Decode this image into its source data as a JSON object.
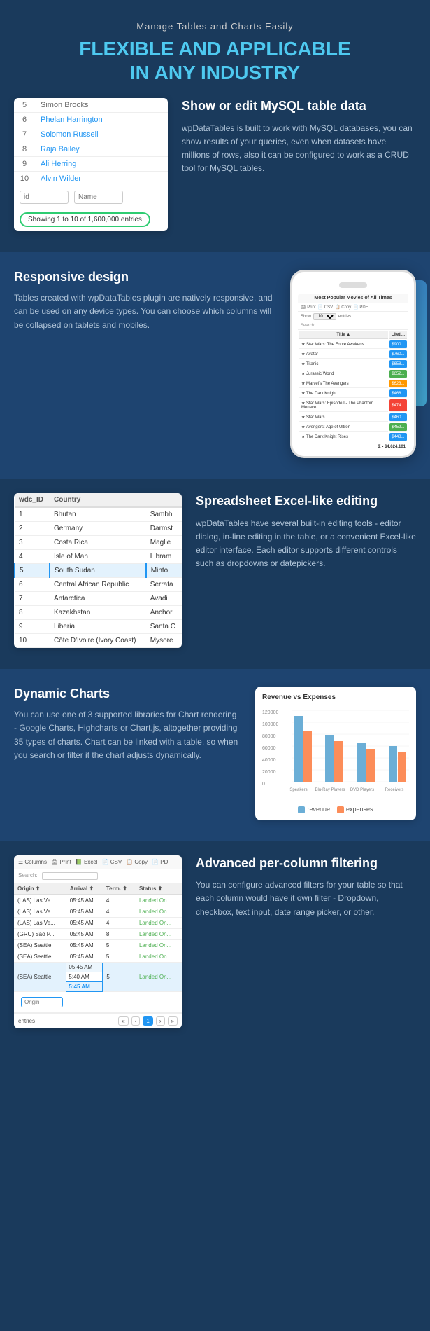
{
  "header": {
    "subtitle": "Manage Tables and Charts Easily",
    "title_part1": "FLEXIBLE AND ",
    "title_highlight": "APPLICABLE",
    "title_part2": "IN ANY INDUSTRY"
  },
  "mysql_section": {
    "heading": "Show or edit MySQL table data",
    "description": "wpDataTables is built to work with MySQL databases, you can show results of your queries, even when datasets have millions of rows, also it can be configured to work as a CRUD tool for MySQL tables.",
    "table": {
      "rows": [
        {
          "id": "5",
          "name": "Simon Brooks"
        },
        {
          "id": "6",
          "name": "Phelan Harrington"
        },
        {
          "id": "7",
          "name": "Solomon Russell"
        },
        {
          "id": "8",
          "name": "Raja Bailey"
        },
        {
          "id": "9",
          "name": "Ali Herring"
        },
        {
          "id": "10",
          "name": "Alvin Wilder"
        }
      ],
      "footer_id_placeholder": "id",
      "footer_name_placeholder": "Name",
      "showing_text": "Showing 1 to 10 of 1,600,000 entries"
    }
  },
  "responsive_section": {
    "heading": "Responsive design",
    "description": "Tables created with wpDataTables plugin are natively responsive, and can be used on any device types. You can choose which columns will be collapsed on tablets and mobiles.",
    "phone": {
      "title": "Most Popular Movies of All Times",
      "toolbar": [
        "Print",
        "CSV",
        "Copy",
        "PDF"
      ],
      "show_label": "Show",
      "entries_label": "entries",
      "search_label": "Search:",
      "col1": "Title",
      "col2": "Lifeti...",
      "rows": [
        {
          "title": "Star Wars: The Force Awakens",
          "value": "$900...",
          "color": "blue"
        },
        {
          "title": "Avatar",
          "value": "$760...",
          "color": "blue"
        },
        {
          "title": "Titanic",
          "value": "$658...",
          "color": "blue"
        },
        {
          "title": "Jurassic World",
          "value": "$652...",
          "color": "green"
        },
        {
          "title": "Marvel's The Avengers",
          "value": "$623...",
          "color": "orange"
        },
        {
          "title": "The Dark Knight",
          "value": "$468...",
          "color": "blue"
        },
        {
          "title": "Star Wars: Episode I - The Phantom Menace",
          "value": "$474...",
          "color": "red"
        },
        {
          "title": "Star Wars",
          "value": "$460...",
          "color": "blue"
        },
        {
          "title": "Avengers: Age of Ultron",
          "value": "$459...",
          "color": "green"
        },
        {
          "title": "The Dark Knight Rises",
          "value": "$448...",
          "color": "blue"
        }
      ],
      "total": "$4,624,101"
    }
  },
  "excel_section": {
    "heading": "Spreadsheet Excel-like editing",
    "description": "wpDataTables have several built-in editing tools - editor dialog, in-line editing in the table, or a convenient Excel-like editor interface. Each editor supports different controls such as dropdowns or datepickers.",
    "table": {
      "col1": "wdc_ID",
      "col2": "Country",
      "col3": "",
      "rows": [
        {
          "id": "1",
          "country": "Bhutan",
          "city": "Sambh"
        },
        {
          "id": "2",
          "country": "Germany",
          "city": "Darmst"
        },
        {
          "id": "3",
          "country": "Costa Rica",
          "city": "Maglie"
        },
        {
          "id": "4",
          "country": "Isle of Man",
          "city": "Libram"
        },
        {
          "id": "5",
          "country": "South Sudan",
          "city": "Minto",
          "highlighted": true
        },
        {
          "id": "6",
          "country": "Central African Republic",
          "city": "Serrata"
        },
        {
          "id": "7",
          "country": "Antarctica",
          "city": "Avadi"
        },
        {
          "id": "8",
          "country": "Kazakhstan",
          "city": "Anchor"
        },
        {
          "id": "9",
          "country": "Liberia",
          "city": "Santa C"
        },
        {
          "id": "10",
          "country": "Côte D'Ivoire (Ivory Coast)",
          "city": "Mysore"
        }
      ]
    }
  },
  "charts_section": {
    "heading": "Dynamic Charts",
    "description": "You can use one of 3 supported libraries for Chart rendering - Google Charts, Highcharts or Chart.js, altogether providing 35 types of charts. Chart can be linked with a table, so when you search or filter it the chart adjusts dynamically.",
    "chart": {
      "title": "Revenue vs Expenses",
      "y_labels": [
        "120000",
        "100000",
        "80000",
        "60000",
        "40000",
        "20000",
        "0"
      ],
      "x_labels": [
        "Speakers",
        "Blu-Ray Players",
        "DVD Players",
        "Receivers"
      ],
      "revenue_values": [
        110000,
        80000,
        65000,
        60000
      ],
      "expenses_values": [
        85000,
        70000,
        55000,
        50000
      ],
      "legend_revenue": "revenue",
      "legend_expenses": "expenses"
    }
  },
  "filtering_section": {
    "heading": "Advanced per-column filtering",
    "description": "You can configure advanced filters for your table so that each column would have it own filter - Dropdown, checkbox, text input, date range picker, or other.",
    "toolbar_items": [
      "Columns",
      "Print",
      "Excel",
      "CSV",
      "Copy",
      "PDF"
    ],
    "search_label": "Search:",
    "table": {
      "col1": "Origin",
      "col2": "Arrival",
      "col3": "Term.",
      "col4": "Status",
      "rows": [
        {
          "origin": "(LAS) Las Ve...",
          "arrival": "05:45 AM",
          "term": "4",
          "status": "Landed On..."
        },
        {
          "origin": "(LAS) Las Ve...",
          "arrival": "05:45 AM",
          "term": "4",
          "status": "Landed On..."
        },
        {
          "origin": "(LAS) Las Ve...",
          "arrival": "05:45 AM",
          "term": "4",
          "status": "Landed On..."
        },
        {
          "origin": "(GRU) Sao P...",
          "arrival": "05:45 AM",
          "term": "8",
          "status": "Landed On..."
        },
        {
          "origin": "(SEA) Seattle",
          "arrival": "05:45 AM",
          "term": "5",
          "status": "Landed On..."
        },
        {
          "origin": "(SEA) Seattle",
          "arrival": "05:45 AM",
          "term": "5",
          "status": "Landed On..."
        },
        {
          "origin": "(SEA) Seattle",
          "arrival": "05:45 AM",
          "term": "5",
          "status": "Landed On...",
          "selected": true
        }
      ],
      "filter_origin_placeholder": "Origin",
      "filter_arrival_values": [
        "5:40 AM",
        "5:45 AM"
      ],
      "pagination": "entries",
      "page_current": "1"
    }
  }
}
